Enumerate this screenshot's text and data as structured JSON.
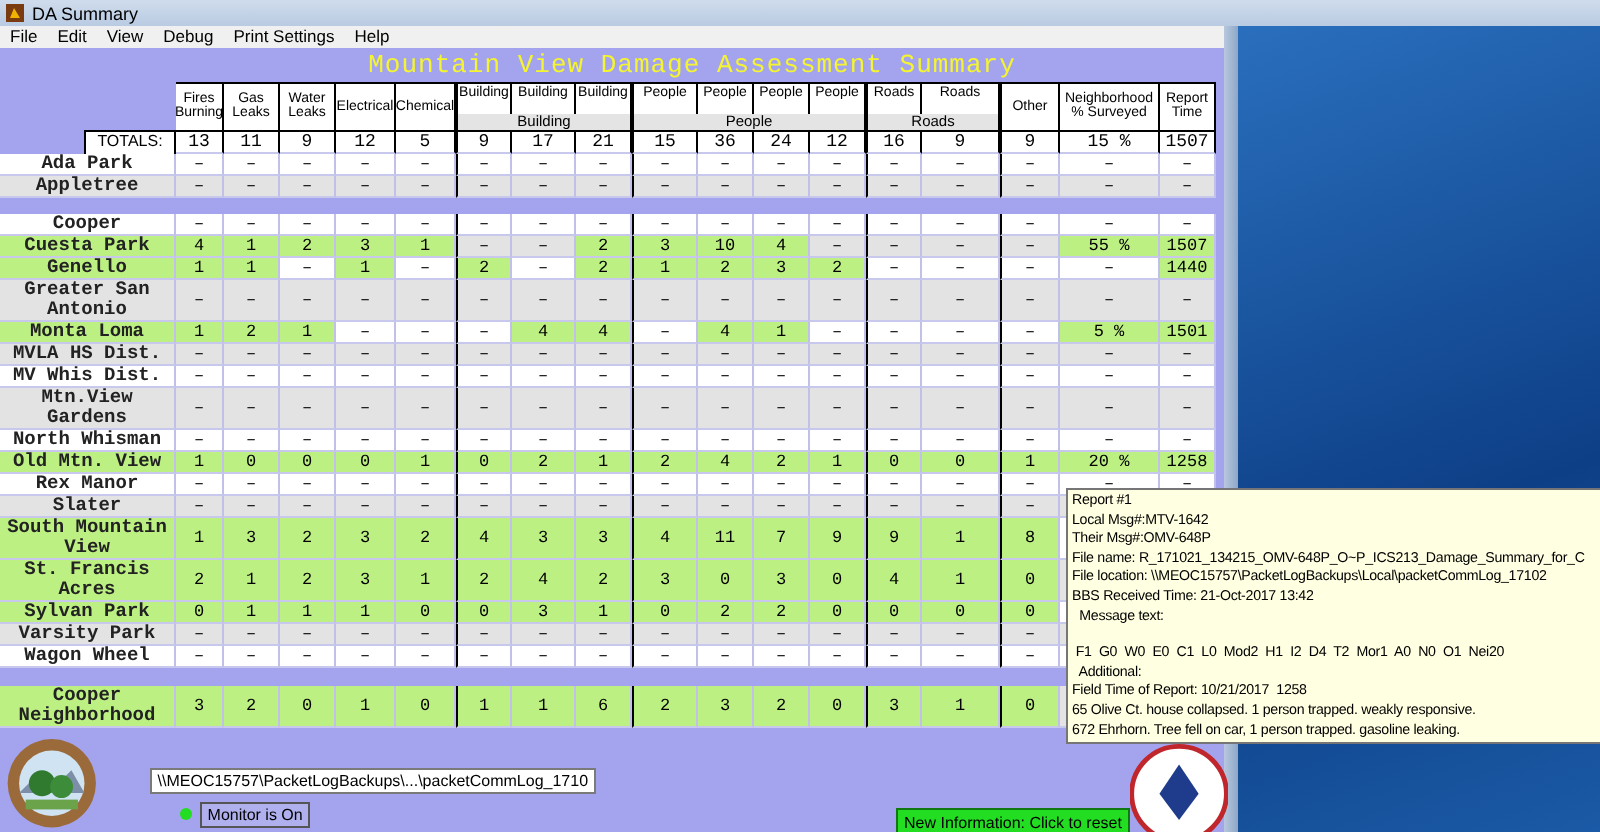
{
  "window": {
    "title": "DA Summary"
  },
  "menu": [
    "File",
    "Edit",
    "View",
    "Debug",
    "Print Settings",
    "Help"
  ],
  "title": "Mountain View Damage Assessment Summary",
  "table": {
    "columns": [
      {
        "label": "Fires Burning"
      },
      {
        "label": "Gas Leaks"
      },
      {
        "label": "Water Leaks"
      },
      {
        "label": "Electrical"
      },
      {
        "label": "Chemical"
      },
      {
        "group": "Building",
        "columns": [
          "Building",
          "Building",
          "Building"
        ]
      },
      {
        "group": "People",
        "columns": [
          "People",
          "People",
          "People",
          "People"
        ]
      },
      {
        "group": "Roads",
        "columns": [
          "Roads",
          "Roads"
        ]
      },
      {
        "label": "Other"
      },
      {
        "label": "Neighborhood % Surveyed"
      },
      {
        "label": "Report Time"
      }
    ],
    "totals_label": "TOTALS:",
    "totals": [
      "13",
      "11",
      "9",
      "12",
      "5",
      "9",
      "17",
      "21",
      "15",
      "36",
      "24",
      "12",
      "16",
      "9",
      "9",
      "15 %",
      "1507"
    ],
    "row_groups": [
      [
        {
          "name": "Ada Park",
          "reported": false,
          "cells": [
            "–",
            "–",
            "–",
            "–",
            "–",
            "–",
            "–",
            "–",
            "–",
            "–",
            "–",
            "–",
            "–",
            "–",
            "–",
            "–",
            "–"
          ]
        },
        {
          "name": "Appletree",
          "reported": false,
          "cells": [
            "–",
            "–",
            "–",
            "–",
            "–",
            "–",
            "–",
            "–",
            "–",
            "–",
            "–",
            "–",
            "–",
            "–",
            "–",
            "–",
            "–"
          ]
        }
      ],
      [
        {
          "name": "Cooper",
          "reported": false,
          "cells": [
            "–",
            "–",
            "–",
            "–",
            "–",
            "–",
            "–",
            "–",
            "–",
            "–",
            "–",
            "–",
            "–",
            "–",
            "–",
            "–",
            "–"
          ]
        },
        {
          "name": "Cuesta Park",
          "reported": true,
          "cells": [
            "4",
            "1",
            "2",
            "3",
            "1",
            "–",
            "–",
            "2",
            "3",
            "10",
            "4",
            "–",
            "–",
            "–",
            "–",
            "55 %",
            "1507"
          ],
          "highlight": [
            true,
            true,
            true,
            true,
            true,
            false,
            false,
            true,
            true,
            true,
            true,
            false,
            false,
            false,
            false,
            true,
            true
          ]
        },
        {
          "name": "Genello",
          "reported": true,
          "cells": [
            "1",
            "1",
            "–",
            "1",
            "–",
            "2",
            "–",
            "2",
            "1",
            "2",
            "3",
            "2",
            "–",
            "–",
            "–",
            "–",
            "1440"
          ],
          "highlight": [
            true,
            true,
            false,
            true,
            false,
            true,
            false,
            true,
            true,
            true,
            true,
            true,
            false,
            false,
            false,
            false,
            true
          ]
        },
        {
          "name": "Greater San Antonio",
          "reported": false,
          "cells": [
            "–",
            "–",
            "–",
            "–",
            "–",
            "–",
            "–",
            "–",
            "–",
            "–",
            "–",
            "–",
            "–",
            "–",
            "–",
            "–",
            "–"
          ]
        },
        {
          "name": "Monta Loma",
          "reported": true,
          "cells": [
            "1",
            "2",
            "1",
            "–",
            "–",
            "–",
            "4",
            "4",
            "–",
            "4",
            "1",
            "–",
            "–",
            "–",
            "–",
            "5 %",
            "1501"
          ],
          "highlight": [
            true,
            true,
            true,
            false,
            false,
            false,
            true,
            true,
            false,
            true,
            true,
            false,
            false,
            false,
            false,
            true,
            true
          ]
        },
        {
          "name": "MVLA HS Dist.",
          "reported": false,
          "cells": [
            "–",
            "–",
            "–",
            "–",
            "–",
            "–",
            "–",
            "–",
            "–",
            "–",
            "–",
            "–",
            "–",
            "–",
            "–",
            "–",
            "–"
          ]
        },
        {
          "name": "MV Whis Dist.",
          "reported": false,
          "cells": [
            "–",
            "–",
            "–",
            "–",
            "–",
            "–",
            "–",
            "–",
            "–",
            "–",
            "–",
            "–",
            "–",
            "–",
            "–",
            "–",
            "–"
          ]
        },
        {
          "name": "Mtn.View Gardens",
          "reported": false,
          "cells": [
            "–",
            "–",
            "–",
            "–",
            "–",
            "–",
            "–",
            "–",
            "–",
            "–",
            "–",
            "–",
            "–",
            "–",
            "–",
            "–",
            "–"
          ]
        },
        {
          "name": "North Whisman",
          "reported": false,
          "cells": [
            "–",
            "–",
            "–",
            "–",
            "–",
            "–",
            "–",
            "–",
            "–",
            "–",
            "–",
            "–",
            "–",
            "–",
            "–",
            "–",
            "–"
          ]
        },
        {
          "name": "Old Mtn. View",
          "reported": true,
          "cells": [
            "1",
            "0",
            "0",
            "0",
            "1",
            "0",
            "2",
            "1",
            "2",
            "4",
            "2",
            "1",
            "0",
            "0",
            "1",
            "20 %",
            "1258"
          ],
          "highlight": [
            true,
            true,
            true,
            true,
            true,
            true,
            true,
            true,
            true,
            true,
            true,
            true,
            true,
            true,
            true,
            true,
            true
          ]
        },
        {
          "name": "Rex Manor",
          "reported": false,
          "cells": [
            "–",
            "–",
            "–",
            "–",
            "–",
            "–",
            "–",
            "–",
            "–",
            "–",
            "–",
            "–",
            "–",
            "–",
            "–",
            "–",
            "–"
          ]
        },
        {
          "name": "Slater",
          "reported": false,
          "cells": [
            "–",
            "–",
            "–",
            "–",
            "–",
            "–",
            "–",
            "–",
            "–",
            "–",
            "–",
            "–",
            "–",
            "–",
            "–"
          ]
        },
        {
          "name": "South Mountain View",
          "reported": true,
          "cells": [
            "1",
            "3",
            "2",
            "3",
            "2",
            "4",
            "3",
            "3",
            "4",
            "11",
            "7",
            "9",
            "9",
            "1",
            "8"
          ],
          "highlight": [
            true,
            true,
            true,
            true,
            true,
            true,
            true,
            true,
            true,
            true,
            true,
            true,
            true,
            true,
            true
          ]
        },
        {
          "name": "St. Francis Acres",
          "reported": true,
          "cells": [
            "2",
            "1",
            "2",
            "3",
            "1",
            "2",
            "4",
            "2",
            "3",
            "0",
            "3",
            "0",
            "4",
            "1",
            "0"
          ],
          "highlight": [
            true,
            true,
            true,
            true,
            true,
            true,
            true,
            true,
            true,
            true,
            true,
            true,
            true,
            true,
            true
          ]
        },
        {
          "name": "Sylvan Park",
          "reported": true,
          "cells": [
            "0",
            "1",
            "1",
            "1",
            "0",
            "0",
            "3",
            "1",
            "0",
            "2",
            "2",
            "0",
            "0",
            "0",
            "0"
          ],
          "highlight": [
            true,
            true,
            true,
            true,
            true,
            true,
            true,
            true,
            true,
            true,
            true,
            true,
            true,
            true,
            true
          ]
        },
        {
          "name": "Varsity Park",
          "reported": false,
          "cells": [
            "–",
            "–",
            "–",
            "–",
            "–",
            "–",
            "–",
            "–",
            "–",
            "–",
            "–",
            "–",
            "–",
            "–",
            "–"
          ]
        },
        {
          "name": "Wagon Wheel",
          "reported": false,
          "cells": [
            "–",
            "–",
            "–",
            "–",
            "–",
            "–",
            "–",
            "–",
            "–",
            "–",
            "–",
            "–",
            "–",
            "–",
            "–"
          ]
        }
      ],
      [
        {
          "name": "Cooper Neighborhood",
          "reported": true,
          "cells": [
            "3",
            "2",
            "0",
            "1",
            "0",
            "1",
            "1",
            "6",
            "2",
            "3",
            "2",
            "0",
            "3",
            "1",
            "0"
          ],
          "highlight": [
            true,
            true,
            true,
            true,
            true,
            true,
            true,
            true,
            true,
            true,
            true,
            true,
            true,
            true,
            true
          ]
        }
      ]
    ]
  },
  "footer": {
    "log_path": "\\\\MEOC15757\\PacketLogBackups\\...\\packetCommLog_1710",
    "monitor": {
      "on": true,
      "label": "Monitor is On"
    },
    "new_info_button": "New Information: Click to reset"
  },
  "tooltip": {
    "header_lines": [
      "Report #1",
      "Local Msg#:MTV-1642",
      "Their Msg#:OMV-648P",
      "File name: R_171021_134215_OMV-648P_O~P_ICS213_Damage_Summary_for_C",
      "File location: \\\\MEOC15757\\PacketLogBackups\\Local\\packetCommLog_17102",
      "BBS Received Time: 21-Oct-2017 13:42",
      "  Message text:"
    ],
    "body_lines": [
      " F1  G0  W0  E0  C1  L0  Mod2  H1  I2  D4  T2  Mor1  A0  N0  O1  Nei20",
      "  Additional:",
      "Field Time of Report: 10/21/2017  1258",
      "65 Olive Ct. house collapsed. 1 person trapped. weakly responsive.",
      "672 Ehrhorn. Tree fell on car, 1 person trapped. gasoline leaking."
    ]
  }
}
